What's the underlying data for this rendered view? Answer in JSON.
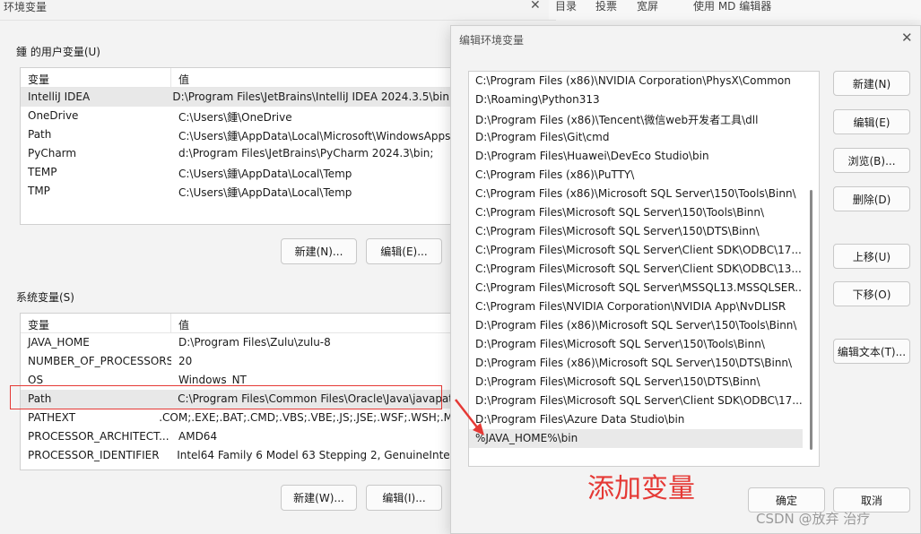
{
  "env_window": {
    "title": "环境变量",
    "close_glyph": "✕",
    "user_group_label": "鍾 的用户变量(U)",
    "system_group_label": "系统变量(S)",
    "col_var": "变量",
    "col_val": "值",
    "user_rows": [
      {
        "name": "IntelliJ IDEA",
        "value": "D:\\Program Files\\JetBrains\\IntelliJ IDEA 2024.3.5\\bin;"
      },
      {
        "name": "OneDrive",
        "value": "C:\\Users\\鍾\\OneDrive"
      },
      {
        "name": "Path",
        "value": "C:\\Users\\鍾\\AppData\\Local\\Microsoft\\WindowsApps"
      },
      {
        "name": "PyCharm",
        "value": "d:\\Program Files\\JetBrains\\PyCharm 2024.3\\bin;"
      },
      {
        "name": "TEMP",
        "value": "C:\\Users\\鍾\\AppData\\Local\\Temp"
      },
      {
        "name": "TMP",
        "value": "C:\\Users\\鍾\\AppData\\Local\\Temp"
      }
    ],
    "system_rows": [
      {
        "name": "JAVA_HOME",
        "value": "D:\\Program Files\\Zulu\\zulu-8"
      },
      {
        "name": "NUMBER_OF_PROCESSORS",
        "value": "20"
      },
      {
        "name": "OS",
        "value": "Windows_NT"
      },
      {
        "name": "Path",
        "value": "C:\\Program Files\\Common Files\\Oracle\\Java\\javapat"
      },
      {
        "name": "PATHEXT",
        "value": ".COM;.EXE;.BAT;.CMD;.VBS;.VBE;.JS;.JSE;.WSF;.WSH;.M"
      },
      {
        "name": "PROCESSOR_ARCHITECT...",
        "value": "AMD64"
      },
      {
        "name": "PROCESSOR_IDENTIFIER",
        "value": "Intel64 Family 6 Model 63 Stepping 2, GenuineIntel"
      }
    ],
    "user_new_btn": "新建(N)...",
    "user_edit_btn": "编辑(E)...",
    "sys_new_btn": "新建(W)...",
    "sys_edit_btn": "编辑(I)..."
  },
  "top_strip": {
    "items": [
      "目录",
      "投票",
      "宽屏",
      "使用 MD 编辑器"
    ]
  },
  "edit_dialog": {
    "title": "编辑环境变量",
    "close_glyph": "✕",
    "paths": [
      "C:\\Program Files (x86)\\NVIDIA Corporation\\PhysX\\Common",
      "D:\\Roaming\\Python313",
      "D:\\Program Files (x86)\\Tencent\\微信web开发者工具\\dll",
      "D:\\Program Files\\Git\\cmd",
      "D:\\Program Files\\Huawei\\DevEco Studio\\bin",
      "C:\\Program Files (x86)\\PuTTY\\",
      "C:\\Program Files (x86)\\Microsoft SQL Server\\150\\Tools\\Binn\\",
      "C:\\Program Files\\Microsoft SQL Server\\150\\Tools\\Binn\\",
      "C:\\Program Files\\Microsoft SQL Server\\150\\DTS\\Binn\\",
      "C:\\Program Files\\Microsoft SQL Server\\Client SDK\\ODBC\\17...",
      "C:\\Program Files\\Microsoft SQL Server\\Client SDK\\ODBC\\13...",
      "C:\\Program Files\\Microsoft SQL Server\\MSSQL13.MSSQLSER...",
      "C:\\Program Files\\NVIDIA Corporation\\NVIDIA App\\NvDLISR",
      "D:\\Program Files (x86)\\Microsoft SQL Server\\150\\Tools\\Binn\\",
      "D:\\Program Files\\Microsoft SQL Server\\150\\Tools\\Binn\\",
      "D:\\Program Files (x86)\\Microsoft SQL Server\\150\\DTS\\Binn\\",
      "D:\\Program Files\\Microsoft SQL Server\\150\\DTS\\Binn\\",
      "D:\\Program Files\\Microsoft SQL Server\\Client SDK\\ODBC\\17...",
      "D:\\Program Files\\Azure Data Studio\\bin",
      "%JAVA_HOME%\\bin"
    ],
    "buttons": {
      "new": "新建(N)",
      "edit": "编辑(E)",
      "browse": "浏览(B)...",
      "delete": "删除(D)",
      "move_up": "上移(U)",
      "move_down": "下移(O)",
      "edit_text": "编辑文本(T)...",
      "ok": "确定",
      "cancel": "取消"
    }
  },
  "annotation": {
    "text": "添加变量",
    "color": "#e53935"
  },
  "watermark": "CSDN @放弃    治疗"
}
